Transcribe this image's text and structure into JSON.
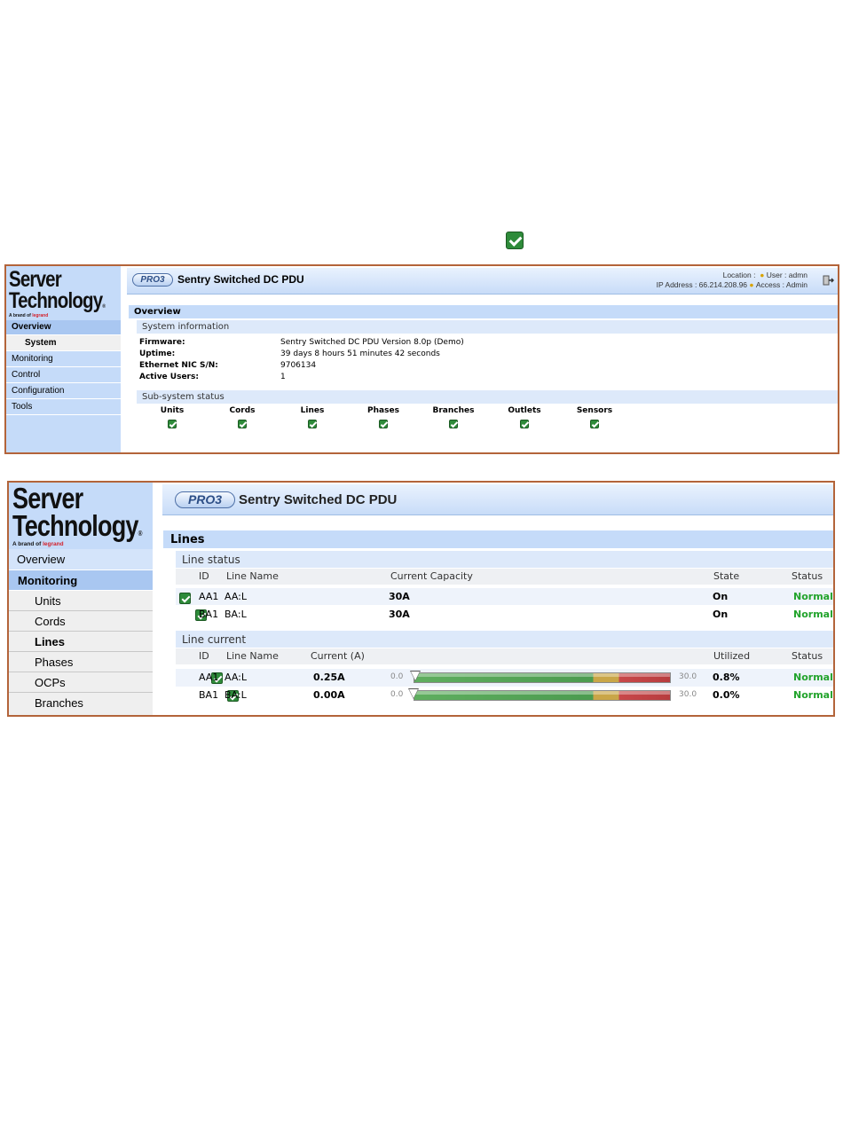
{
  "top_icon": "checkmark-icon",
  "panel1": {
    "logo": {
      "line1": "Server",
      "line2": "Technology",
      "reg": "®",
      "brand_prefix": "A brand of",
      "brand_name": "legrand"
    },
    "header": {
      "badge": "PRO3",
      "title": "Sentry Switched DC PDU",
      "location_label": "Location :",
      "location_value": "",
      "user_label": "User : admn",
      "ip_label": "IP Address : 66.214.208.96",
      "access_label": "Access : Admin",
      "logout_icon": "logout-icon"
    },
    "sidebar": {
      "items": [
        {
          "label": "Overview"
        },
        {
          "label": "System"
        },
        {
          "label": "Monitoring"
        },
        {
          "label": "Control"
        },
        {
          "label": "Configuration"
        },
        {
          "label": "Tools"
        }
      ]
    },
    "page_title": "Overview",
    "system_info": {
      "title": "System information",
      "rows": [
        {
          "label": "Firmware:",
          "value": "Sentry Switched DC PDU Version 8.0p (Demo)"
        },
        {
          "label": "Uptime:",
          "value": "39 days 8 hours 51 minutes 42 seconds"
        },
        {
          "label": "Ethernet NIC S/N:",
          "value": "9706134"
        },
        {
          "label": "Active Users:",
          "value": "1"
        }
      ]
    },
    "subsystem": {
      "title": "Sub-system status",
      "items": [
        "Units",
        "Cords",
        "Lines",
        "Phases",
        "Branches",
        "Outlets",
        "Sensors"
      ]
    }
  },
  "panel2": {
    "logo": {
      "line1": "Server",
      "line2": "Technology",
      "reg": "®",
      "brand_prefix": "A brand of",
      "brand_name": "legrand"
    },
    "header": {
      "badge": "PRO3",
      "title": "Sentry Switched DC PDU"
    },
    "sidebar": {
      "items": [
        {
          "label": "Overview"
        },
        {
          "label": "Monitoring"
        },
        {
          "label": "Units"
        },
        {
          "label": "Cords"
        },
        {
          "label": "Lines"
        },
        {
          "label": "Phases"
        },
        {
          "label": "OCPs"
        },
        {
          "label": "Branches"
        }
      ]
    },
    "page_title": "Lines",
    "line_status": {
      "title": "Line status",
      "headers": [
        "ID",
        "Line Name",
        "Current Capacity",
        "State",
        "Status"
      ],
      "rows": [
        {
          "id": "AA1",
          "name": "AA:L",
          "capacity": "30A",
          "state": "On",
          "status": "Normal"
        },
        {
          "id": "BA1",
          "name": "BA:L",
          "capacity": "30A",
          "state": "On",
          "status": "Normal"
        }
      ]
    },
    "line_current": {
      "title": "Line current",
      "headers": [
        "ID",
        "Line Name",
        "Current (A)",
        "Utilized",
        "Status"
      ],
      "rows": [
        {
          "id": "AA1",
          "name": "AA:L",
          "current": "0.25A",
          "gauge_min": "0.0",
          "gauge_max": "30.0",
          "gauge_value": 0.25,
          "utilized": "0.8%",
          "status": "Normal"
        },
        {
          "id": "BA1",
          "name": "BA:L",
          "current": "0.00A",
          "gauge_min": "0.0",
          "gauge_max": "30.0",
          "gauge_value": 0.0,
          "utilized": "0.0%",
          "status": "Normal"
        }
      ]
    }
  },
  "colors": {
    "accent_border": "#b3643a",
    "sidebar_bg": "#c5dbf9",
    "normal_green": "#22a32c",
    "check_green": "#2e8b3a"
  }
}
